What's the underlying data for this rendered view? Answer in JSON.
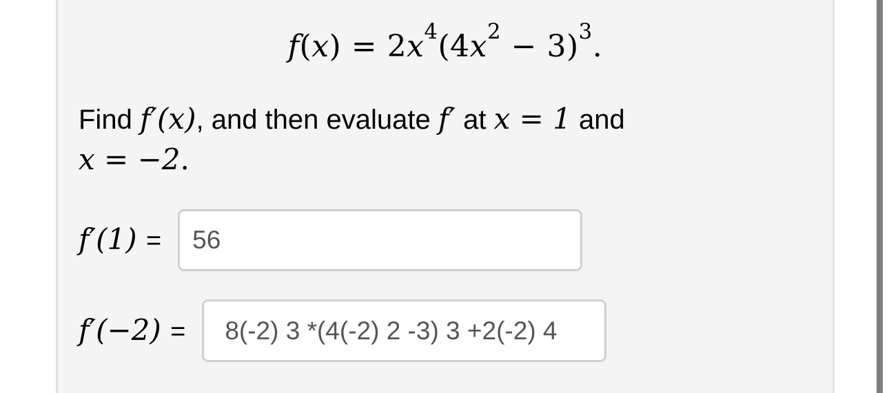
{
  "problem": {
    "function_equation": {
      "lhs": "f(x)",
      "lhs_func": "f",
      "lhs_var": "x",
      "equals": "=",
      "coef": "2",
      "var": "x",
      "exp_outer_var": "4",
      "open_paren": "(",
      "inner_coef": "4",
      "inner_var": "x",
      "inner_exp": "2",
      "minus": "−",
      "inner_const": "3",
      "close_paren": ")",
      "exp_outer": "3",
      "period": "."
    },
    "prompt": {
      "find": "Find",
      "fprime_x": "f′(x)",
      "middle": ", and then evaluate",
      "fprime": "f′",
      "at": "at",
      "x_eq_1": "x = 1",
      "and": "and",
      "x_eq_neg2": "x = −2",
      "end": "."
    }
  },
  "answers": [
    {
      "label": "f′(1)",
      "equals": "=",
      "value": "56"
    },
    {
      "label": "f′(−2)",
      "equals": "=",
      "value": "8(-2) 3 *(4(-2) 2 -3) 3 +2(-2) 4"
    }
  ],
  "colors": {
    "panel_background": "#f4f4f4",
    "input_border": "#cfcfcf",
    "input_text": "#555555",
    "scrollbar": "#7f7f7f"
  }
}
